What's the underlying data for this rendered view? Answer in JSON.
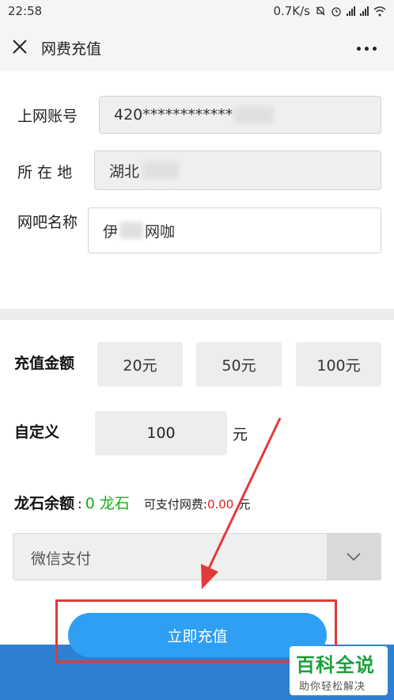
{
  "status_bar": {
    "time": "22:58",
    "speed": "0.7K/s"
  },
  "nav": {
    "title": "网费充值"
  },
  "account": {
    "account_label": "上网账号",
    "account_value": "420************",
    "location_label": "所 在 地",
    "location_value": "湖北",
    "cafe_label": "网吧名称",
    "cafe_value_start": "伊",
    "cafe_value_end": "网咖"
  },
  "recharge": {
    "amount_label": "充值金额",
    "options": [
      "20元",
      "50元",
      "100元"
    ],
    "custom_label": "自定义",
    "custom_value": "100",
    "unit": "元"
  },
  "balance": {
    "label": "龙石余额",
    "colon": ":",
    "value": "0 龙石",
    "payable_label": "可支付网费:",
    "payable_value": "0.00",
    "payable_unit": "元"
  },
  "payment": {
    "selected": "微信支付"
  },
  "submit": {
    "label": "立即充值"
  },
  "watermark": {
    "title": "百科全说",
    "subtitle": "助你轻松解决"
  },
  "colors": {
    "accent_blue": "#2f9ff3",
    "band_blue": "#2f7fd3",
    "annotation_red": "#e23a3a",
    "balance_green": "#1aad19",
    "payable_red": "#e02020"
  }
}
